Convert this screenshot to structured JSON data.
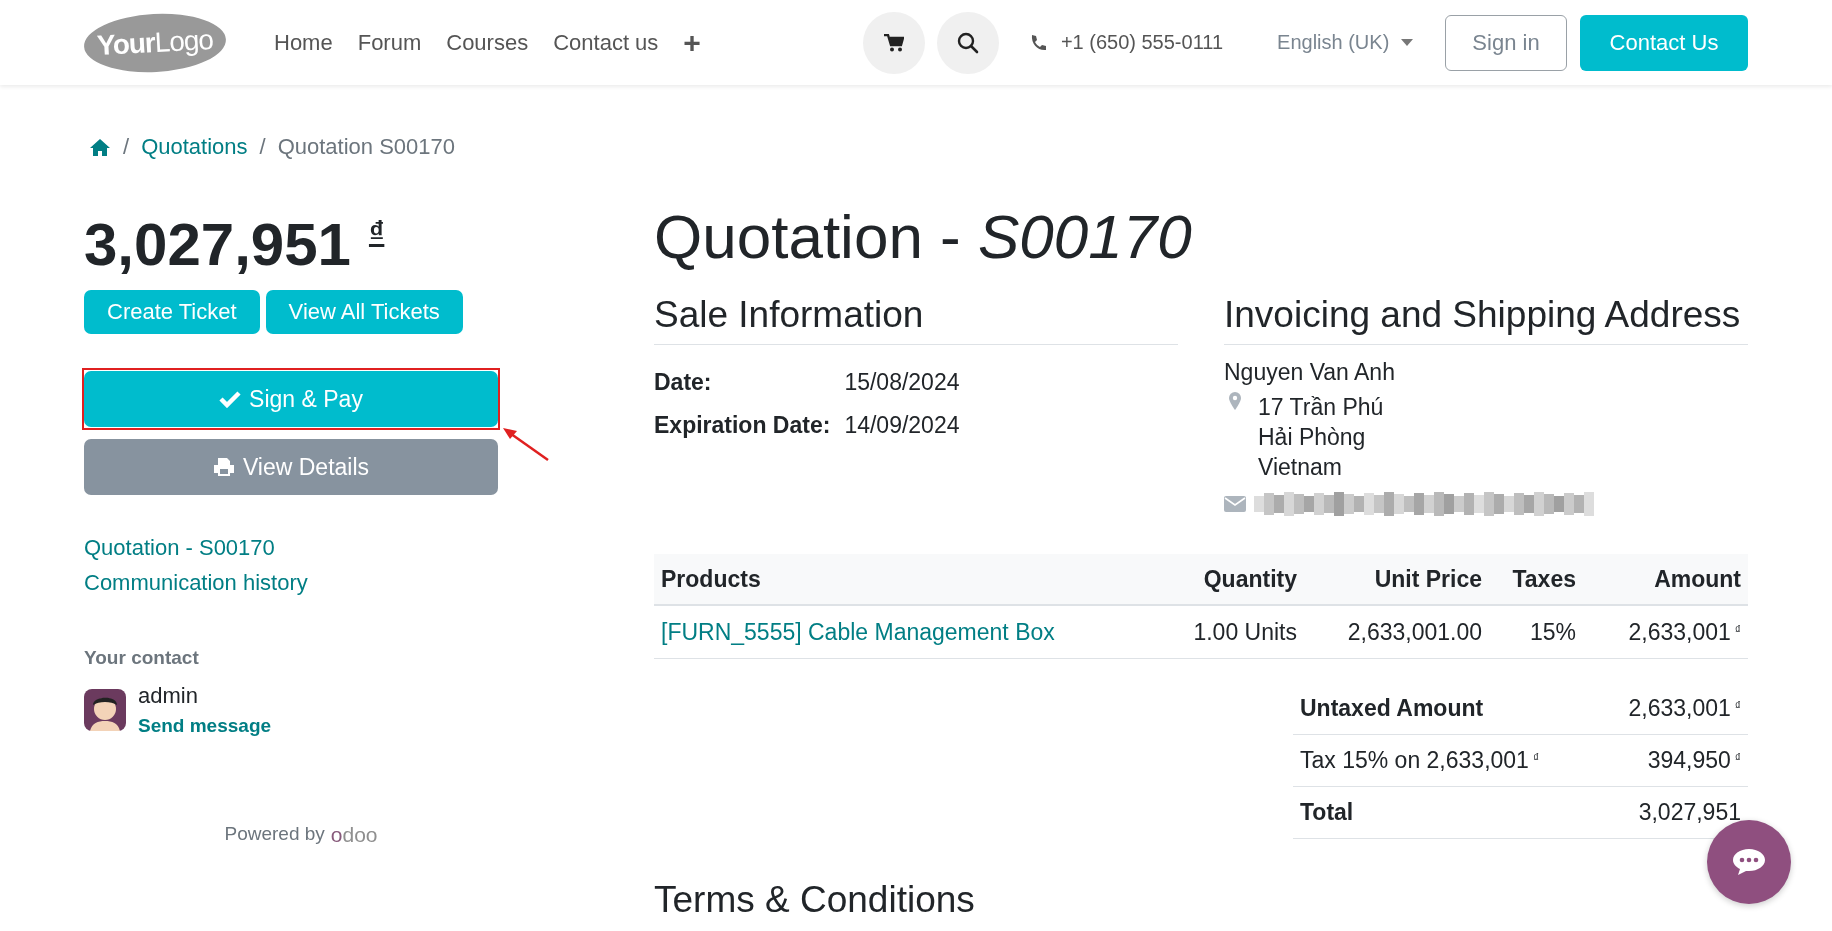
{
  "header": {
    "logo": "**Your**Logo",
    "nav": [
      {
        "label": "Home"
      },
      {
        "label": "Forum"
      },
      {
        "label": "Courses"
      },
      {
        "label": "Contact us"
      }
    ],
    "nav_more": "+",
    "phone": "+1 (650) 555-0111",
    "language": "English (UK)",
    "sign_in": "Sign in",
    "contact_button": "Contact Us"
  },
  "breadcrumb": {
    "items": [
      {
        "separator": "/",
        "label": "Quotations"
      },
      {
        "separator": "/",
        "label": "Quotation S00170"
      }
    ]
  },
  "sidebar": {
    "amount": "3,027,951",
    "currency": "₫",
    "ticket_buttons": [
      {
        "label": "Create Ticket"
      },
      {
        "label": "View All Tickets"
      }
    ],
    "actions": [
      {
        "label": "Sign & Pay",
        "kind": "primary",
        "annotated": true
      },
      {
        "label": "View Details",
        "kind": "secondary",
        "annotated": false
      }
    ],
    "links": [
      {
        "label": "Quotation - S00170"
      },
      {
        "label": "Communication history"
      }
    ],
    "contact_label": "Your contact",
    "contact_name": "admin",
    "contact_action": "Send message",
    "powered_by": "Powered by",
    "brand": "odoo"
  },
  "document": {
    "title": "Quotation - *S00170*",
    "sale_info": {
      "heading": "Sale Information",
      "fields": [
        {
          "label": "Date:",
          "value": "15/08/2024"
        },
        {
          "label": "Expiration Date:",
          "value": "14/09/2024"
        }
      ]
    },
    "address": {
      "heading": "Invoicing and Shipping Address",
      "name": "Nguyen Van Anh",
      "lines": [
        "17 Trần Phú",
        "Hải Phòng",
        "Vietnam"
      ]
    },
    "table": {
      "columns": [
        "Products",
        "Quantity",
        "Unit Price",
        "Taxes",
        "Amount"
      ],
      "rows": [
        {
          "product": "[FURN_5555] Cable Management Box",
          "quantity": "1.00 Units",
          "unit_price": "2,633,001.00",
          "taxes": "15%",
          "amount": "2,633,001",
          "currency": "₫"
        }
      ]
    },
    "totals": [
      {
        "label": "Untaxed Amount",
        "value": "2,633,001",
        "currency": "₫",
        "bold": true
      },
      {
        "label": "Tax 15% on 2,633,001",
        "label_currency": "₫",
        "value": "394,950",
        "currency": "₫",
        "bold": false
      },
      {
        "label": "Total",
        "value": "3,027,951",
        "bold": true
      }
    ],
    "terms_heading": "Terms & Conditions"
  }
}
